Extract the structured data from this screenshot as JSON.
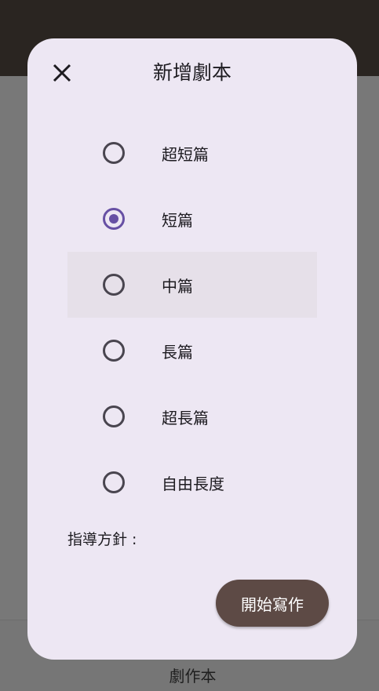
{
  "dialog": {
    "title": "新增劇本",
    "close_icon": "close-icon",
    "options": [
      {
        "label": "超短篇",
        "checked": false
      },
      {
        "label": "短篇",
        "checked": true
      },
      {
        "label": "中篇",
        "checked": false
      },
      {
        "label": "長篇",
        "checked": false
      },
      {
        "label": "超長篇",
        "checked": false
      },
      {
        "label": "自由長度",
        "checked": false
      }
    ],
    "guideline_label": "指導方針 :",
    "start_button": "開始寫作"
  },
  "bottom_nav": {
    "label": "劇作本"
  },
  "colors": {
    "accent": "#6750a4",
    "button": "#5d4a45",
    "dialog_bg": "#ede7f3"
  }
}
